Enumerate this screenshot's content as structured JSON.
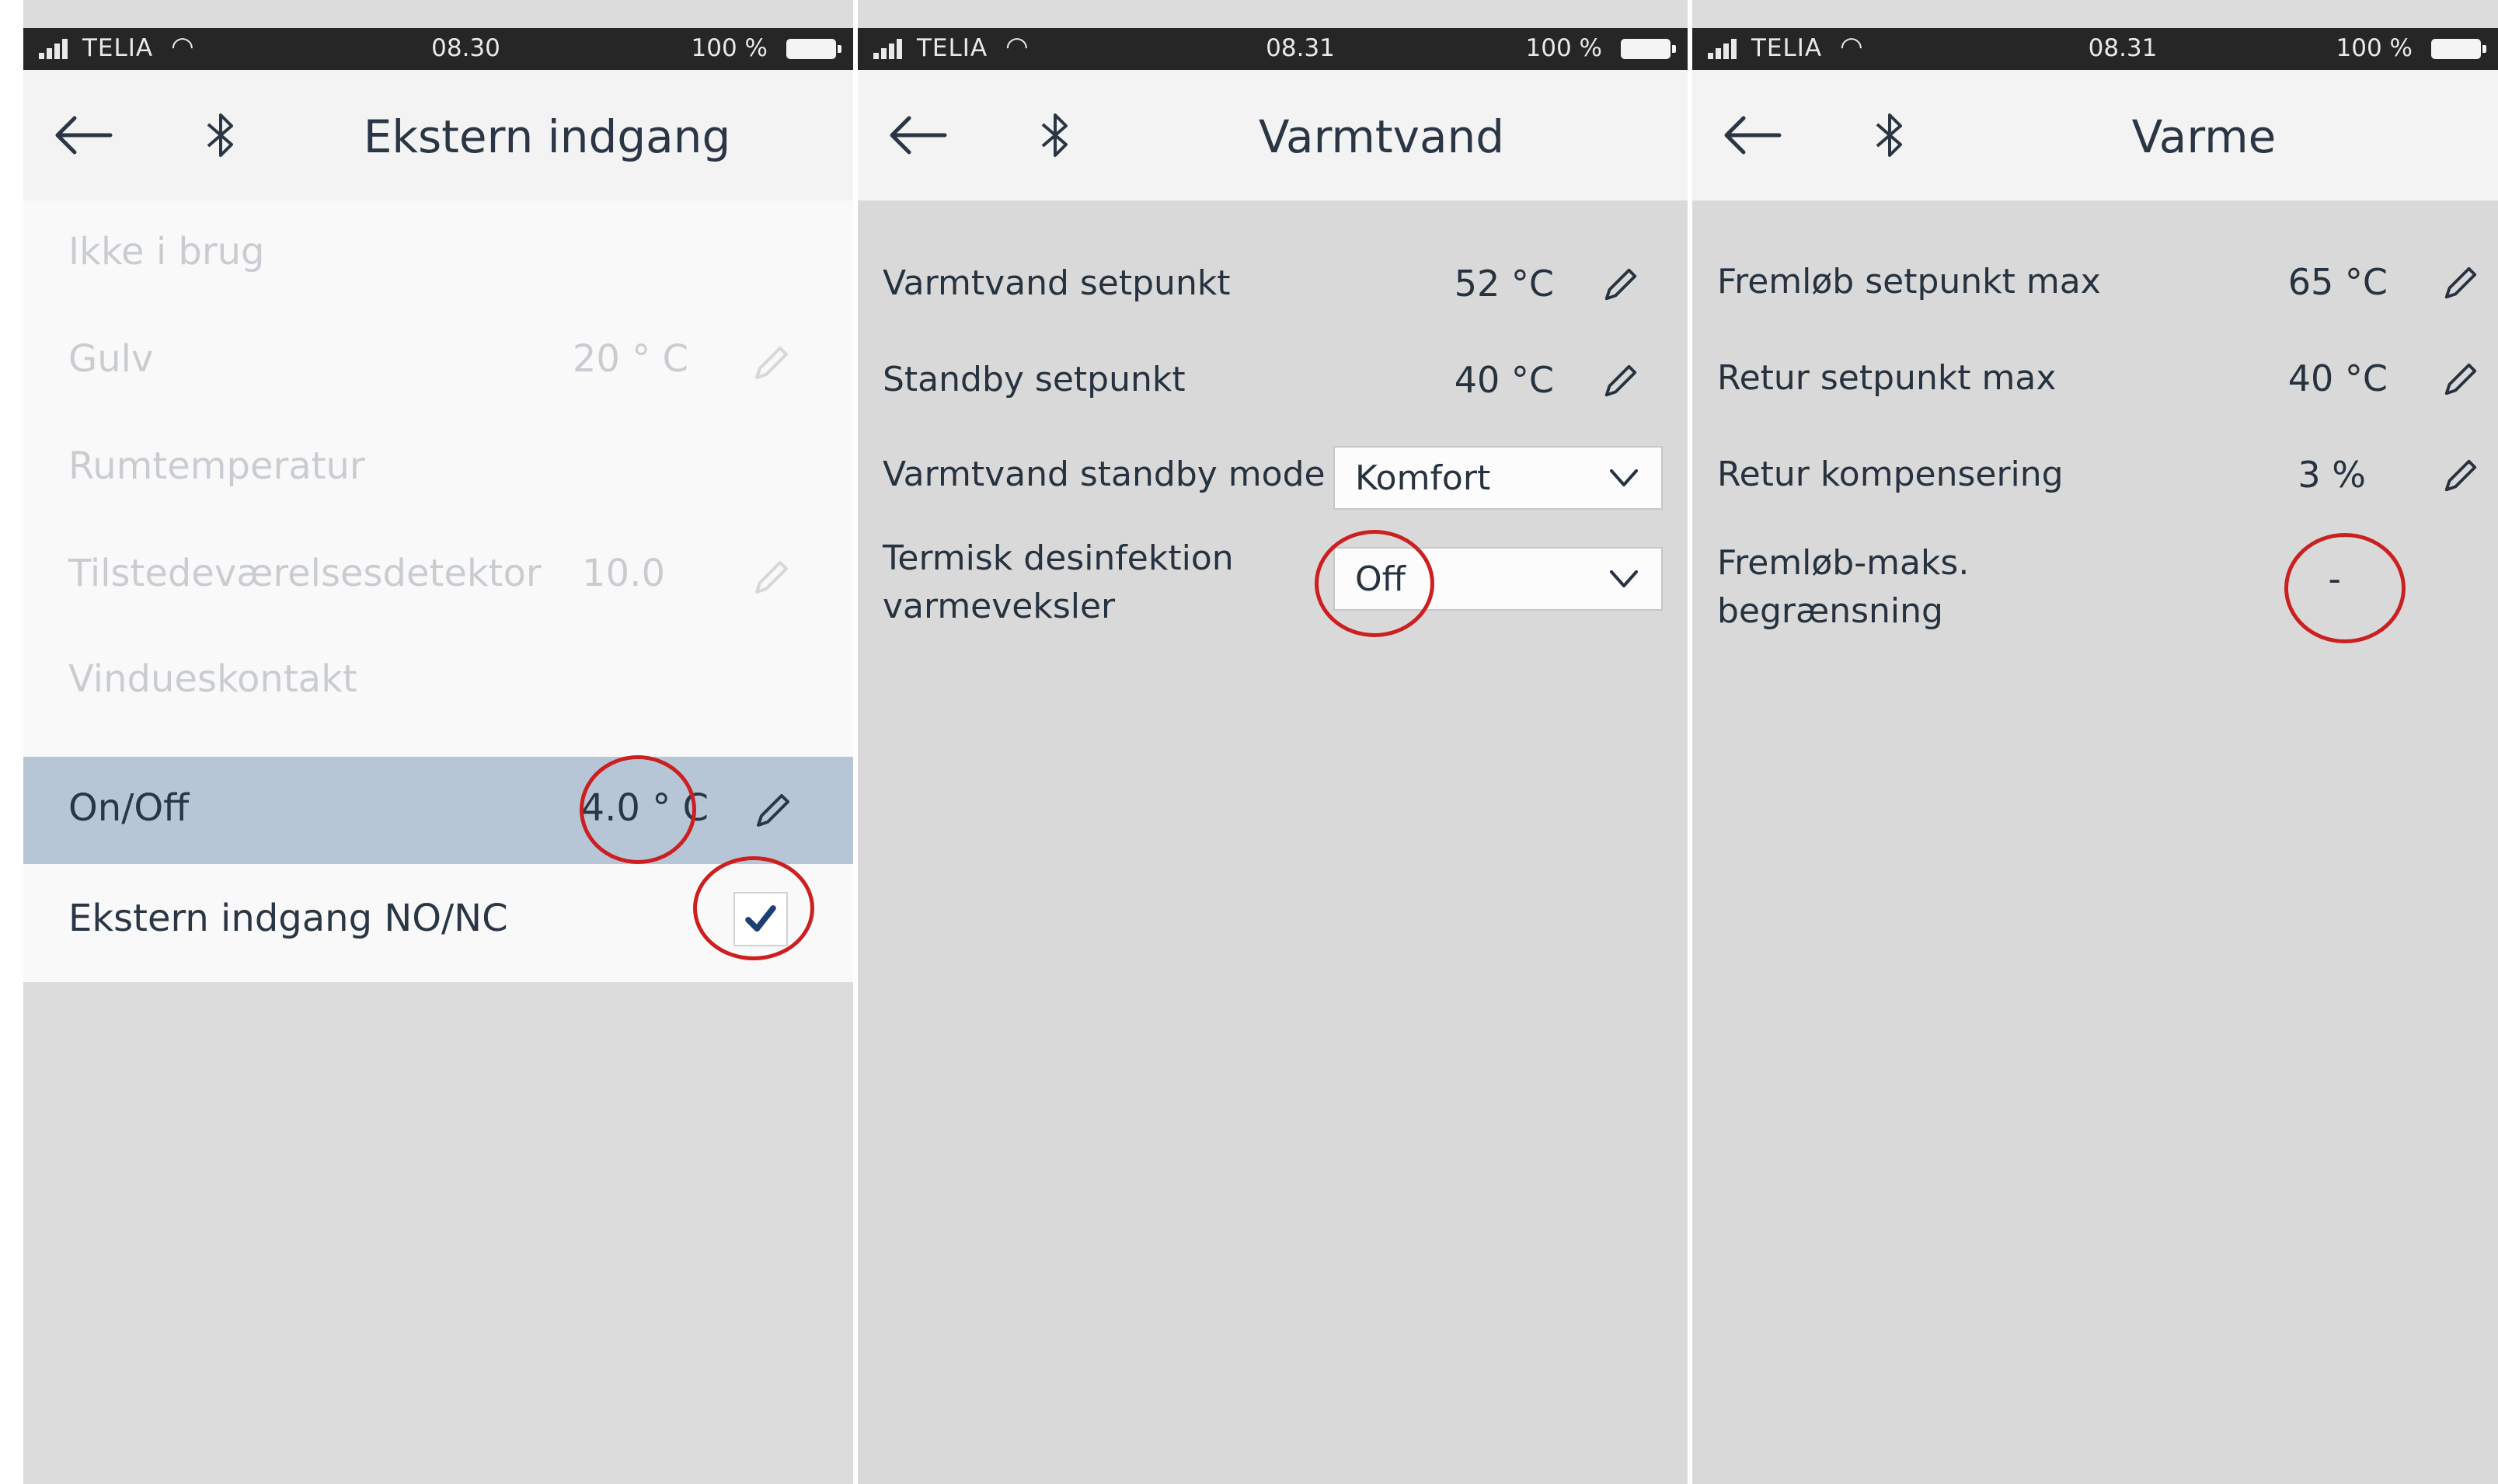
{
  "status": {
    "p1": {
      "carrier": "TELIA",
      "time": "08.30",
      "battery": "100 %"
    },
    "p2": {
      "carrier": "TELIA",
      "time": "08.31",
      "battery": "100 %"
    },
    "p3": {
      "carrier": "TELIA",
      "time": "08.31",
      "battery": "100 %"
    }
  },
  "screen1": {
    "title": "Ekstern indgang",
    "rows": [
      {
        "label": "Ikke i brug",
        "value": ""
      },
      {
        "label": "Gulv",
        "value": "20 ° C"
      },
      {
        "label": "Rumtemperatur",
        "value": ""
      },
      {
        "label": "Tilstedeværelsesdetektor",
        "value": "10.0"
      },
      {
        "label": "Vindueskontakt",
        "value": ""
      },
      {
        "label": "On/Off",
        "value": "4.0 ° C"
      },
      {
        "label": "Ekstern indgang NO/NC",
        "value": ""
      }
    ],
    "checkbox_checked": true
  },
  "screen2": {
    "title": "Varmtvand",
    "rows": [
      {
        "label": "Varmtvand setpunkt",
        "value": "52 °C"
      },
      {
        "label": "Standby setpunkt",
        "value": "40 °C"
      },
      {
        "label": "Varmtvand standby mode",
        "value": "Komfort"
      },
      {
        "label_line1": "Termisk desinfektion",
        "label_line2": "varmeveksler",
        "value": "Off"
      }
    ]
  },
  "screen3": {
    "title": "Varme",
    "rows": [
      {
        "label": "Fremløb setpunkt max",
        "value": "65 °C"
      },
      {
        "label": "Retur setpunkt max",
        "value": "40 °C"
      },
      {
        "label": "Retur kompensering",
        "value": "3 %"
      },
      {
        "label_line1": "Fremløb-maks.",
        "label_line2": "begrænsning",
        "value": "-"
      }
    ]
  },
  "icons": {
    "back": "arrow-left",
    "bluetooth": "bluetooth",
    "edit": "pencil",
    "dropdown": "chevron-down",
    "check": "checkmark"
  },
  "colors": {
    "annotation_circle": "#cc1f1f",
    "selected_row": "#b7c6d6",
    "status_bar": "#262626",
    "checkmark": "#1d3f74"
  }
}
